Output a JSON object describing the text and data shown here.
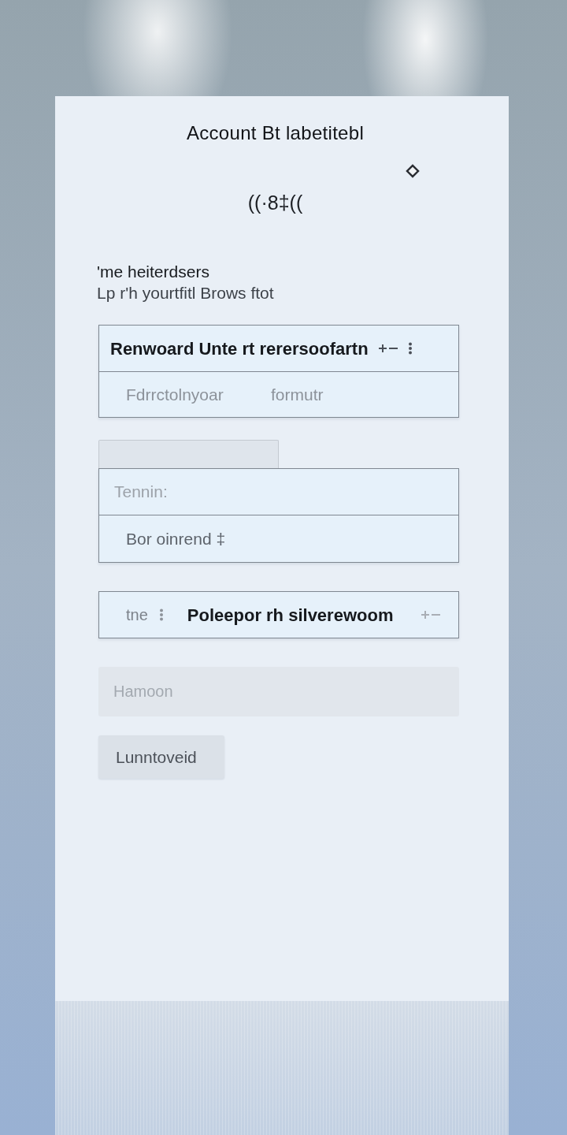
{
  "header": {
    "title": "Account Bt labetitebl",
    "badge_text": "((·8‡(("
  },
  "intro": {
    "heading": "'me heiterdsers",
    "subheading": "Lp r'h yourtfitl Brows ftot"
  },
  "panel_1": {
    "rows": [
      {
        "kind": "heading",
        "text": "Renwoard  Unte rt rerersoofartn"
      },
      {
        "kind": "pair",
        "text": "Fdrrctolnyoar",
        "value": "formutr"
      }
    ]
  },
  "panel_2": {
    "rows": [
      {
        "kind": "hint",
        "text": "Tennin:"
      },
      {
        "kind": "plain",
        "text": "Bor oinrend ‡"
      }
    ]
  },
  "panel_3": {
    "rows": [
      {
        "kind": "labelled",
        "label": "tne",
        "text": "Poleepor rh silverewoom"
      }
    ]
  },
  "search_field": {
    "placeholder": "Hamoon"
  },
  "button": {
    "label": "Lunntoveid"
  }
}
